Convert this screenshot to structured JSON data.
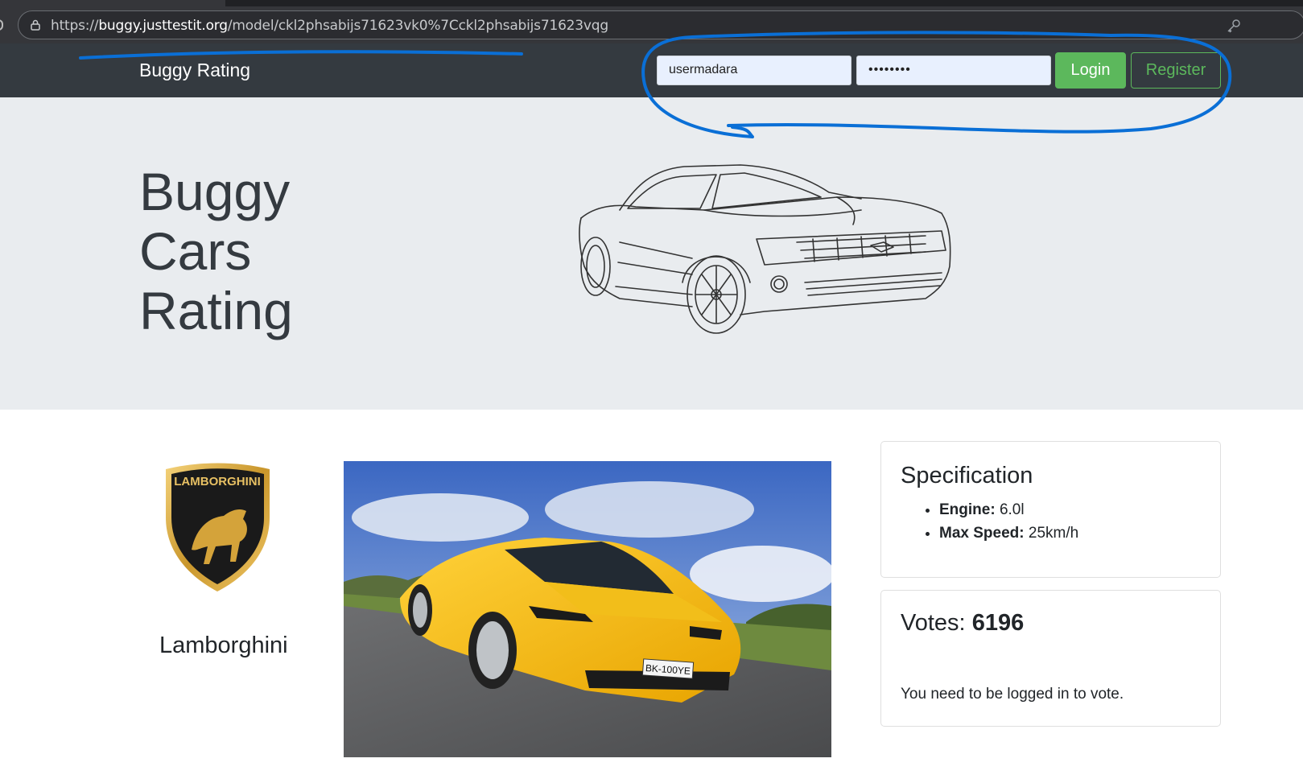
{
  "browser": {
    "url_scheme": "https://",
    "url_host": "buggy.justtestit.org",
    "url_path": "/model/ckl2phsabijs71623vk0%7Cckl2phsabijs71623vqg"
  },
  "navbar": {
    "brand": "Buggy Rating",
    "login_value": "usermadara",
    "password_value": "••••••••",
    "login_button": "Login",
    "register_button": "Register"
  },
  "hero": {
    "title_line1": "Buggy",
    "title_line2": "Cars",
    "title_line3": "Rating"
  },
  "make": {
    "logo_text": "LAMBORGHINI",
    "name": "Lamborghini"
  },
  "car_photo": {
    "plate": "BK-100YE"
  },
  "specification": {
    "title": "Specification",
    "engine_label": "Engine:",
    "engine_value": "6.0l",
    "speed_label": "Max Speed:",
    "speed_value": "25km/h"
  },
  "votes": {
    "label": "Votes:",
    "count": "6196",
    "message": "You need to be logged in to vote."
  },
  "colors": {
    "navbar_bg": "#343a40",
    "success_green": "#5cb85c",
    "jumbotron_bg": "#e9ecef",
    "annotation_blue": "#0a6fd6"
  }
}
